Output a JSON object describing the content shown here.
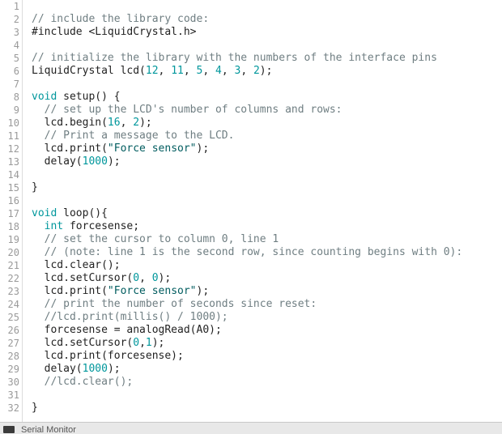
{
  "editor": {
    "gutter": [
      "1",
      "2",
      "3",
      "4",
      "5",
      "6",
      "7",
      "8",
      "9",
      "10",
      "11",
      "12",
      "13",
      "14",
      "15",
      "16",
      "17",
      "18",
      "19",
      "20",
      "21",
      "22",
      "23",
      "24",
      "25",
      "26",
      "27",
      "28",
      "29",
      "30",
      "31",
      "32"
    ],
    "lines": [
      [],
      [
        {
          "t": "// include the library code:",
          "c": "comment"
        }
      ],
      [
        {
          "t": "#include <LiquidCrystal.h>",
          "c": "plain"
        }
      ],
      [],
      [
        {
          "t": "// initialize the library with the numbers of the interface pins",
          "c": "comment"
        }
      ],
      [
        {
          "t": "LiquidCrystal lcd(",
          "c": "plain"
        },
        {
          "t": "12",
          "c": "number"
        },
        {
          "t": ", ",
          "c": "plain"
        },
        {
          "t": "11",
          "c": "number"
        },
        {
          "t": ", ",
          "c": "plain"
        },
        {
          "t": "5",
          "c": "number"
        },
        {
          "t": ", ",
          "c": "plain"
        },
        {
          "t": "4",
          "c": "number"
        },
        {
          "t": ", ",
          "c": "plain"
        },
        {
          "t": "3",
          "c": "number"
        },
        {
          "t": ", ",
          "c": "plain"
        },
        {
          "t": "2",
          "c": "number"
        },
        {
          "t": ");",
          "c": "plain"
        }
      ],
      [],
      [
        {
          "t": "void",
          "c": "keyword"
        },
        {
          "t": " setup() {",
          "c": "plain"
        }
      ],
      [
        {
          "t": "  // set up the LCD's number of columns and rows:",
          "c": "comment"
        }
      ],
      [
        {
          "t": "  lcd.begin(",
          "c": "plain"
        },
        {
          "t": "16",
          "c": "number"
        },
        {
          "t": ", ",
          "c": "plain"
        },
        {
          "t": "2",
          "c": "number"
        },
        {
          "t": ");",
          "c": "plain"
        }
      ],
      [
        {
          "t": "  // Print a message to the LCD.",
          "c": "comment"
        }
      ],
      [
        {
          "t": "  lcd.print(",
          "c": "plain"
        },
        {
          "t": "\"Force sensor\"",
          "c": "string"
        },
        {
          "t": ");",
          "c": "plain"
        }
      ],
      [
        {
          "t": "  delay(",
          "c": "plain"
        },
        {
          "t": "1000",
          "c": "number"
        },
        {
          "t": ");",
          "c": "plain"
        }
      ],
      [],
      [
        {
          "t": "}",
          "c": "plain"
        }
      ],
      [],
      [
        {
          "t": "void",
          "c": "keyword"
        },
        {
          "t": " loop(){",
          "c": "plain"
        }
      ],
      [
        {
          "t": "  ",
          "c": "plain"
        },
        {
          "t": "int",
          "c": "type"
        },
        {
          "t": " forcesense;",
          "c": "plain"
        }
      ],
      [
        {
          "t": "  // set the cursor to column 0, line 1",
          "c": "comment"
        }
      ],
      [
        {
          "t": "  // (note: line 1 is the second row, since counting begins with 0):",
          "c": "comment"
        }
      ],
      [
        {
          "t": "  lcd.clear();",
          "c": "plain"
        }
      ],
      [
        {
          "t": "  lcd.setCursor(",
          "c": "plain"
        },
        {
          "t": "0",
          "c": "number"
        },
        {
          "t": ", ",
          "c": "plain"
        },
        {
          "t": "0",
          "c": "number"
        },
        {
          "t": ");",
          "c": "plain"
        }
      ],
      [
        {
          "t": "  lcd.print(",
          "c": "plain"
        },
        {
          "t": "\"Force sensor\"",
          "c": "string"
        },
        {
          "t": ");",
          "c": "plain"
        }
      ],
      [
        {
          "t": "  // print the number of seconds since reset:",
          "c": "comment"
        }
      ],
      [
        {
          "t": "  //lcd.print(millis() / 1000);",
          "c": "comment"
        }
      ],
      [
        {
          "t": "  forcesense = analogRead(A0);",
          "c": "plain"
        }
      ],
      [
        {
          "t": "  lcd.setCursor(",
          "c": "plain"
        },
        {
          "t": "0",
          "c": "number"
        },
        {
          "t": ",",
          "c": "plain"
        },
        {
          "t": "1",
          "c": "number"
        },
        {
          "t": ");",
          "c": "plain"
        }
      ],
      [
        {
          "t": "  lcd.print(forcesense);",
          "c": "plain"
        }
      ],
      [
        {
          "t": "  delay(",
          "c": "plain"
        },
        {
          "t": "1000",
          "c": "number"
        },
        {
          "t": ");",
          "c": "plain"
        }
      ],
      [
        {
          "t": "  //lcd.clear();",
          "c": "comment"
        }
      ],
      [],
      [
        {
          "t": "}",
          "c": "plain"
        }
      ]
    ]
  },
  "console": {
    "icon": "serial-monitor-icon",
    "label": "Serial Monitor"
  }
}
